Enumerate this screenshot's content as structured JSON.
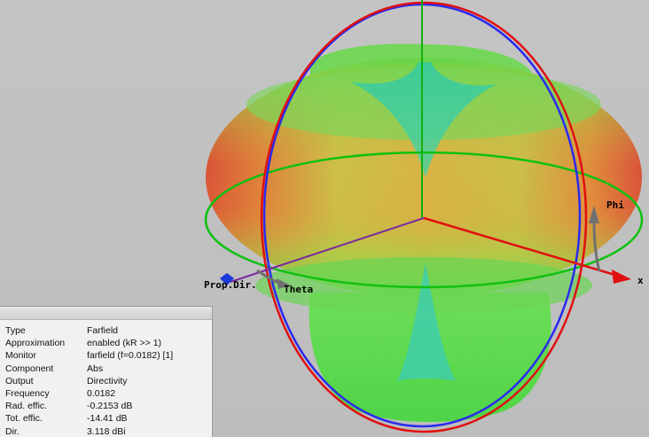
{
  "viewport": {
    "background_color": "#c2c2c2"
  },
  "axes": {
    "x_label": "x",
    "phi_label": "Phi",
    "theta_label": "Theta",
    "prop_dir_label": "Prop.Dir.",
    "x_color": "#e01010",
    "y_color": "#7a2aa0",
    "z_color": "#10b010"
  },
  "circles": {
    "blue_color": "#2a2aee",
    "red_color": "#e01010",
    "green_color": "#10c010"
  },
  "info": {
    "rows": [
      {
        "key": "Type",
        "value": "Farfield"
      },
      {
        "key": "Approximation",
        "value": "enabled (kR >> 1)"
      },
      {
        "key": "Monitor",
        "value": "farfield (f=0.0182) [1]"
      },
      {
        "key": "Component",
        "value": "Abs"
      },
      {
        "key": "Output",
        "value": "Directivity"
      },
      {
        "key": "Frequency",
        "value": "0.0182"
      },
      {
        "key": "Rad. effic.",
        "value": "-0.2153 dB"
      },
      {
        "key": "Tot. effic.",
        "value": "-14.41 dB"
      },
      {
        "key": "Dir.",
        "value": "3.118 dBi"
      }
    ]
  }
}
